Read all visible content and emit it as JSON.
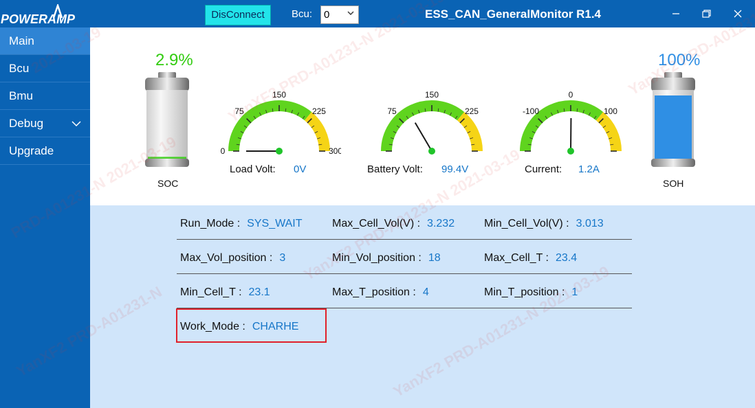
{
  "header": {
    "logo_text": "POWERAMP",
    "disconnect_label": "DisConnect",
    "bcu_label": "Bcu:",
    "bcu_value": "0",
    "title": "ESS_CAN_GeneralMonitor R1.4"
  },
  "sidebar": {
    "items": [
      {
        "label": "Main"
      },
      {
        "label": "Bcu"
      },
      {
        "label": "Bmu"
      },
      {
        "label": "Debug"
      },
      {
        "label": "Upgrade"
      }
    ]
  },
  "soc": {
    "percent": "2.9%",
    "caption": "SOC",
    "level": 0.029,
    "color": "#33cc11"
  },
  "soh": {
    "percent": "100%",
    "caption": "SOH",
    "level": 1.0,
    "color": "#2f8fe4"
  },
  "gauges": [
    {
      "label": "Load Volt:",
      "value": "0V",
      "ticks": [
        "0",
        "75",
        "150",
        "225",
        "300"
      ],
      "min": 0,
      "max": 300,
      "reading": 0
    },
    {
      "label": "Battery Volt:",
      "value": "99.4V",
      "ticks": [
        "75",
        "150",
        "225"
      ],
      "min": 0,
      "max": 300,
      "reading": 99.4
    },
    {
      "label": "Current:",
      "value": "1.2A",
      "ticks": [
        "-100",
        "0",
        "100"
      ],
      "min": -200,
      "max": 200,
      "reading": 1.2
    }
  ],
  "info": [
    [
      {
        "label": "Run_Mode :",
        "value": "SYS_WAIT"
      },
      {
        "label": "Max_Cell_Vol(V) :",
        "value": "3.232"
      },
      {
        "label": "Min_Cell_Vol(V) :",
        "value": "3.013"
      }
    ],
    [
      {
        "label": "Max_Vol_position :",
        "value": "3"
      },
      {
        "label": "Min_Vol_position :",
        "value": "18"
      },
      {
        "label": "Max_Cell_T :",
        "value": "23.4"
      }
    ],
    [
      {
        "label": "Min_Cell_T :",
        "value": "23.1"
      },
      {
        "label": "Max_T_position :",
        "value": "4"
      },
      {
        "label": "Min_T_position :",
        "value": "1"
      }
    ],
    [
      {
        "label": "Work_Mode :",
        "value": "CHARHE"
      }
    ]
  ],
  "watermark": {
    "user": "YanXF2",
    "id": "PRD-A01231-N",
    "date": "2021-03-19"
  }
}
